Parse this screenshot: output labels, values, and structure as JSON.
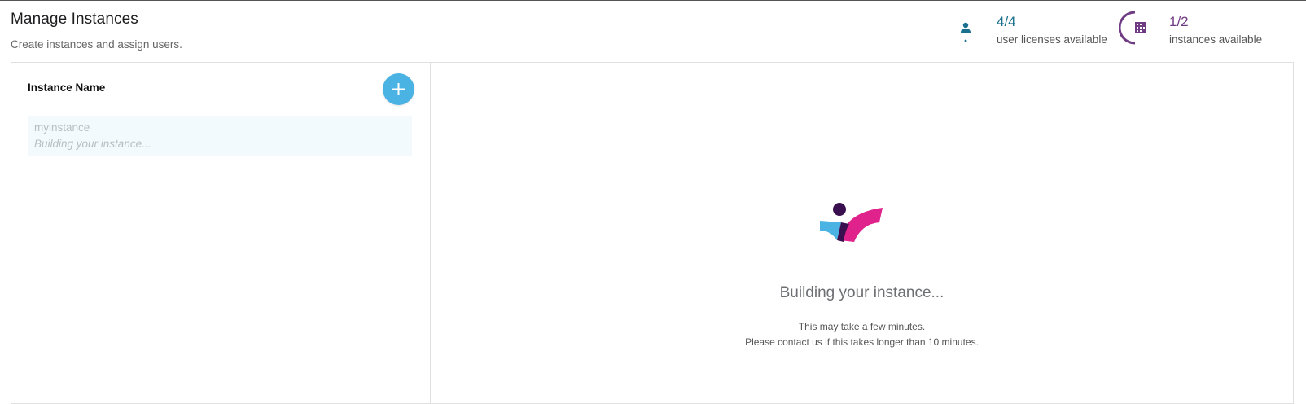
{
  "header": {
    "title": "Manage Instances",
    "subtitle": "Create instances and assign users."
  },
  "stats": {
    "users": {
      "value": "4/4",
      "label": "user licenses available",
      "icon": "person-icon",
      "color": "#1b6f8f"
    },
    "instances": {
      "value": "1/2",
      "label": "instances available",
      "icon": "building-icon",
      "color": "#6f3b83"
    }
  },
  "list": {
    "header": "Instance Name",
    "add_button_icon": "plus-icon",
    "items": [
      {
        "name": "myinstance",
        "status": "Building your instance..."
      }
    ]
  },
  "detail": {
    "title": "Building your instance...",
    "line1": "This may take a few minutes.",
    "line2": "Please contact us if this takes longer than 10 minutes."
  },
  "colors": {
    "accent_blue": "#4bb3e3",
    "logo_pink": "#e0238c",
    "logo_purple": "#3a0f4f",
    "logo_light_blue": "#4bb3e3"
  }
}
